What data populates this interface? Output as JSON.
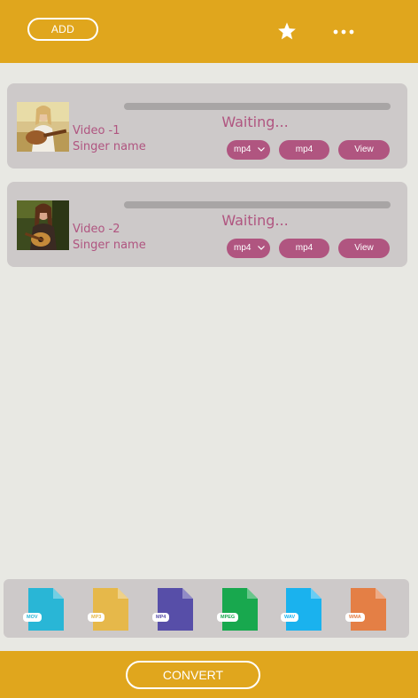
{
  "header": {
    "add_label": "ADD"
  },
  "items": [
    {
      "title": "Video -1",
      "artist": "Singer name",
      "status": "Waiting...",
      "progress": 0,
      "format_select": "mp4",
      "format_button": "mp4",
      "view_label": "View"
    },
    {
      "title": "Video -2",
      "artist": "Singer name",
      "status": "Waiting...",
      "progress": 0,
      "format_select": "mp4",
      "format_button": "mp4",
      "view_label": "View"
    }
  ],
  "formats": [
    {
      "label": "MOV",
      "color": "#29b6d6"
    },
    {
      "label": "MP3",
      "color": "#e6b84a"
    },
    {
      "label": "MP4",
      "color": "#574ea8"
    },
    {
      "label": "MPEG",
      "color": "#18a84e"
    },
    {
      "label": "WAV",
      "color": "#1ab2ee"
    },
    {
      "label": "WMA",
      "color": "#e47f45"
    }
  ],
  "footer": {
    "convert_label": "CONVERT"
  },
  "colors": {
    "accent": "#e0a61d",
    "primary": "#b05580",
    "card": "#cdc9c9",
    "background": "#e8e8e3"
  }
}
